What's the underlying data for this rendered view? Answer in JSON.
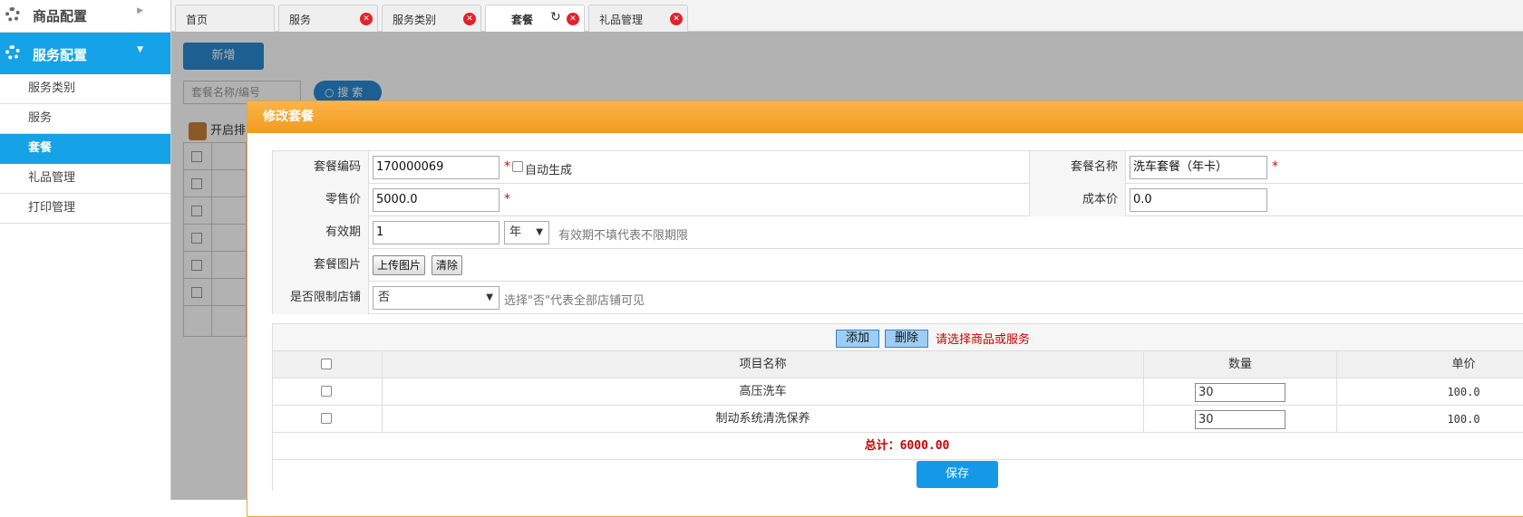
{
  "sidebar": {
    "groups": [
      {
        "label": "商品配置",
        "icon": "gear-icon"
      },
      {
        "label": "服务配置",
        "icon": "gear-icon",
        "expanded": true
      }
    ],
    "items": [
      {
        "label": "服务类别"
      },
      {
        "label": "服务"
      },
      {
        "label": "套餐",
        "active": true
      },
      {
        "label": "礼品管理"
      },
      {
        "label": "打印管理"
      }
    ]
  },
  "tabs": [
    {
      "label": "首页"
    },
    {
      "label": "服务"
    },
    {
      "label": "服务类别"
    },
    {
      "label": "套餐",
      "active": true
    },
    {
      "label": "礼品管理"
    }
  ],
  "background": {
    "new_button": "新增",
    "search_placeholder": "套餐名称/编号",
    "search_button": "搜 索",
    "toolbar_label": "开启排"
  },
  "modal": {
    "title": "修改套餐",
    "fields": {
      "code_label": "套餐编码",
      "code_value": "170000069",
      "auto_label": "自动生成",
      "name_label": "套餐名称",
      "name_value": "洗车套餐（年卡）",
      "price_label": "零售价",
      "price_value": "5000.0",
      "cost_label": "成本价",
      "cost_value": "0.0",
      "validity_label": "有效期",
      "validity_value": "1",
      "validity_unit": "年",
      "validity_hint": "有效期不填代表不限期限",
      "image_label": "套餐图片",
      "upload_button": "上传图片",
      "clear_button": "清除",
      "store_label": "是否限制店铺",
      "store_value": "否",
      "store_hint": "选择\"否\"代表全部店铺可见"
    },
    "items": {
      "add_button": "添加",
      "delete_button": "删除",
      "message": "请选择商品或服务",
      "headers": {
        "name": "项目名称",
        "qty": "数量",
        "price": "单价"
      },
      "rows": [
        {
          "name": "高压洗车",
          "qty": "30",
          "price": "100.0"
        },
        {
          "name": "制动系统清洗保养",
          "qty": "30",
          "price": "100.0"
        }
      ],
      "total": "总计：6000.00"
    },
    "save_button": "保存"
  },
  "colors": {
    "accent": "#15a2e6",
    "modal_header": "#f39a1e",
    "required": "#e00000"
  }
}
